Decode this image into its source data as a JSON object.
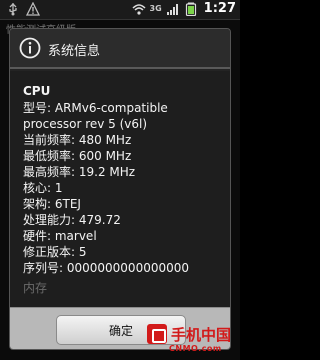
{
  "status_bar": {
    "network": "3G",
    "time": "1:27",
    "icons": [
      "usb-icon",
      "warning-icon",
      "wifi-icon",
      "signal-icon",
      "battery-icon"
    ]
  },
  "background": {
    "title": "性能测试高级版"
  },
  "dialog": {
    "title": "系统信息",
    "icon": "info-icon",
    "section": "CPU",
    "rows": [
      "型号: ARMv6-compatible",
      "processor rev 5 (v6l)",
      "当前频率: 480 MHz",
      "最低频率: 600 MHz",
      "最高频率: 19.2 MHz",
      "核心: 1",
      "架构: 6TEJ",
      "处理能力: 479.72",
      "硬件: marvel",
      "修正版本: 5",
      "序列号: 0000000000000000"
    ],
    "faded_text": "内存",
    "ok_label": "确定"
  },
  "watermark": {
    "cn": "手机中国",
    "en": "CNMO.com"
  },
  "colors": {
    "watermark": "#d21a1a",
    "dialog_bg": "#1e1e1e",
    "footer_bg": "#b8b8b8"
  }
}
